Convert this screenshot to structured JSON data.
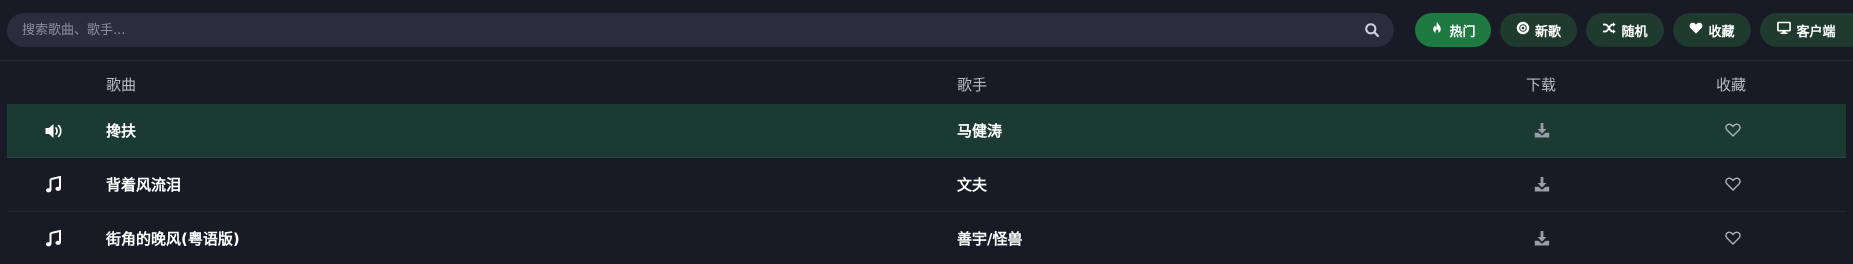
{
  "search": {
    "placeholder": "搜索歌曲、歌手...",
    "value": ""
  },
  "nav": [
    {
      "label": "热门",
      "icon": "fire-icon",
      "active": true
    },
    {
      "label": "新歌",
      "icon": "disc-icon",
      "active": false
    },
    {
      "label": "随机",
      "icon": "shuffle-icon",
      "active": false
    },
    {
      "label": "收藏",
      "icon": "heart-icon",
      "active": false
    },
    {
      "label": "客户端",
      "icon": "desktop-icon",
      "active": false
    }
  ],
  "table": {
    "headers": {
      "song": "歌曲",
      "artist": "歌手",
      "download": "下载",
      "favorite": "收藏"
    },
    "rows": [
      {
        "title": "搀扶",
        "artist": "马健涛",
        "status_icon": "volume-icon",
        "playing": true
      },
      {
        "title": "背着风流泪",
        "artist": "文夫",
        "status_icon": "music-note-icon",
        "playing": false
      },
      {
        "title": "街角的晚风(粤语版)",
        "artist": "善宇/怪兽",
        "status_icon": "music-note-icon",
        "playing": false
      }
    ]
  },
  "colors": {
    "background": "#181a25",
    "search_bg": "#2a2d3b",
    "accent_active": "#1f7a42",
    "nav_button_bg": "#1f3a2f",
    "playing_row_bg": "#1b3a31"
  }
}
